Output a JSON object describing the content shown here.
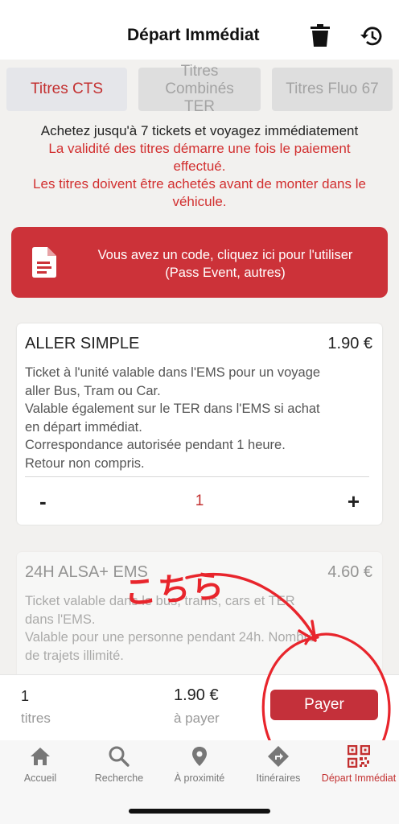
{
  "header": {
    "title": "Départ Immédiat",
    "icons": [
      "trash-icon",
      "history-icon"
    ]
  },
  "tabs": [
    {
      "label": "Titres CTS",
      "active": true
    },
    {
      "label": "Titres Combinés TER",
      "active": false
    },
    {
      "label": "Titres Fluo 67",
      "active": false
    }
  ],
  "info": {
    "line1": "Achetez jusqu'à 7 tickets et voyagez immédiatement",
    "line2": "La validité des titres démarre une fois le paiement effectué.",
    "line3": "Les titres doivent être achetés avant de monter dans le véhicule."
  },
  "code_button": {
    "line1": "Vous avez un code, cliquez ici pour l'utiliser",
    "line2": "(Pass Event, autres)",
    "icon": "document-icon"
  },
  "tickets": [
    {
      "title": "ALLER SIMPLE",
      "price": "1.90 €",
      "desc": [
        "Ticket à l'unité valable dans l'EMS pour un voyage",
        "aller Bus, Tram ou Car.",
        "Valable également sur le TER dans l'EMS si achat",
        "en départ immédiat.",
        "Correspondance autorisée pendant 1 heure.",
        "Retour non compris."
      ],
      "qty_minus": "-",
      "quantity": "1",
      "qty_plus": "+"
    },
    {
      "title": "24H ALSA+ EMS",
      "price": "4.60 €",
      "desc": [
        "Ticket valable dans le bus, trams, cars et TER",
        "dans l'EMS.",
        "Valable pour une personne pendant 24h. Nombre",
        "de trajets illimité."
      ]
    }
  ],
  "annotation": {
    "text": "こちら",
    "color": "#e8252c"
  },
  "summary": {
    "count": "1",
    "count_label": "titres",
    "total": "1.90 €",
    "total_label": "à payer",
    "pay_label": "Payer"
  },
  "nav": [
    {
      "label": "Accueil",
      "icon": "home-icon",
      "active": false
    },
    {
      "label": "Recherche",
      "icon": "search-icon",
      "active": false
    },
    {
      "label": "À proximité",
      "icon": "location-pin-icon",
      "active": false
    },
    {
      "label": "Itinéraires",
      "icon": "directions-icon",
      "active": false
    },
    {
      "label": "Départ Immédiat",
      "icon": "qr-code-icon",
      "active": true
    }
  ],
  "colors": {
    "accent": "#cc3239",
    "active_text": "#c33030",
    "background": "#f2f1ef"
  }
}
